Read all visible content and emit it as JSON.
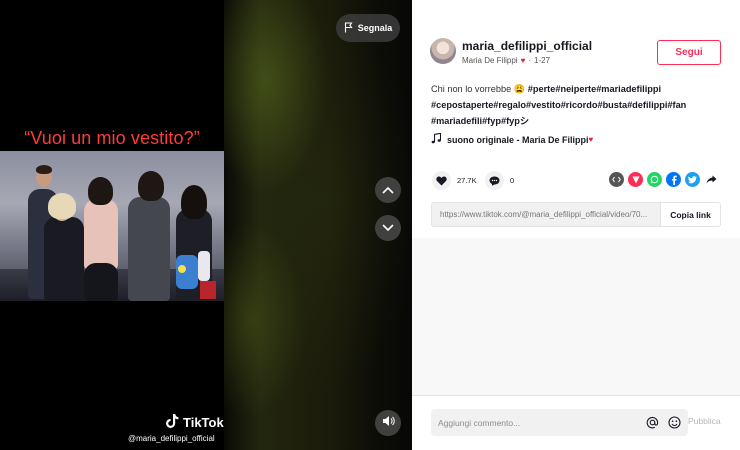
{
  "video": {
    "caption_overlay": "“Vuoi un mio vestito?”",
    "brand": "TikTok",
    "handle": "@maria_defilippi_official",
    "report_label": "Segnala",
    "icons": [
      "flag-icon",
      "chevron-up-icon",
      "chevron-down-icon",
      "speaker-icon",
      "tiktok-logo-icon"
    ]
  },
  "author": {
    "username": "maria_defilippi_official",
    "display_name": "Maria De Filippi",
    "heart": "♥",
    "separator": "·",
    "date": "1-27",
    "follow_label": "Segui"
  },
  "description": {
    "text": "Chi non lo vorrebbe",
    "emoji": "😩",
    "hashtags": "#perte#neiperte#mariadefilippi #cepostaperte#regalo#vestito#ricordo#busta#defilippi#fan #mariadefili#fyp#fypシ"
  },
  "music": {
    "label": "suono originale - Maria De Filippi",
    "heart": "♥"
  },
  "stats": {
    "likes": "27.7K",
    "comments": "0"
  },
  "share": {
    "icons": [
      "embed-icon",
      "send-icon",
      "whatsapp-icon",
      "facebook-icon",
      "twitter-icon",
      "share-arrow-icon"
    ],
    "colors": {
      "embed": "#555555",
      "send": "#fe2c55",
      "whatsapp": "#25d366",
      "facebook": "#0075fa",
      "twitter": "#1da1f2"
    }
  },
  "link": {
    "url": "https://www.tiktok.com/@maria_defilippi_official/video/70...",
    "copy_label": "Copia link"
  },
  "comment_bar": {
    "placeholder": "Aggiungi commento...",
    "post_label": "Pubblica"
  },
  "colors": {
    "accent": "#fe2c55",
    "caption_red": "#ff3b3b"
  }
}
